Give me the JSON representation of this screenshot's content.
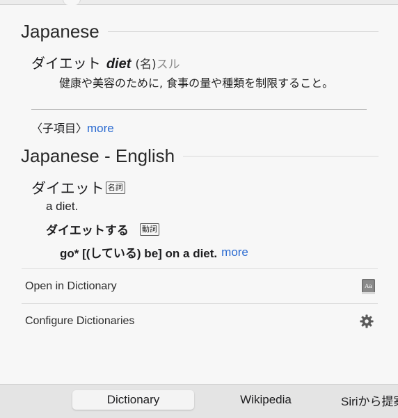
{
  "japanese": {
    "heading": "Japanese",
    "headword_jp": "ダイエット",
    "headword_en": "diet",
    "pos": "(名)",
    "conj": "スル",
    "definition": "健康や美容のために, 食事の量や種類を制限すること。",
    "subitems_label": "〈子項目〉",
    "more": "more"
  },
  "japanese_english": {
    "heading": "Japanese - English",
    "headword": "ダイエット",
    "headword_tag": "名詞",
    "sense1": "a diet.",
    "sub_headword": "ダイエットする",
    "sub_tag": "動詞",
    "sense2": "go* [(している) be] on a diet.",
    "more": "more"
  },
  "actions": {
    "open_in_dictionary": "Open in Dictionary",
    "configure_dictionaries": "Configure Dictionaries",
    "open_icon": "dictionary-app-icon",
    "configure_icon": "gear-icon"
  },
  "tabs": [
    {
      "label": "Dictionary",
      "selected": true
    },
    {
      "label": "Wikipedia",
      "selected": false
    },
    {
      "label": "Siriから提案",
      "selected": false
    }
  ],
  "colors": {
    "link": "#2b6bd1",
    "background": "#f7f7f7",
    "tab_bar": "#e4e4e4"
  }
}
